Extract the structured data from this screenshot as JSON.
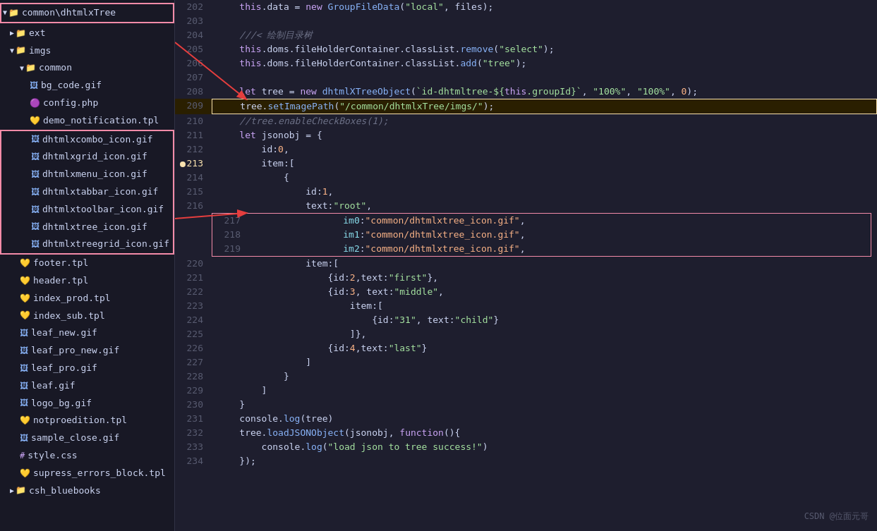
{
  "sidebar": {
    "items": [
      {
        "id": "root-common",
        "label": "common\\dhtmlxTree",
        "type": "folder-open",
        "indent": 0,
        "expanded": true,
        "highlighted": true
      },
      {
        "id": "ext",
        "label": "ext",
        "type": "folder-closed",
        "indent": 1,
        "expanded": false
      },
      {
        "id": "imgs",
        "label": "imgs",
        "type": "folder-open",
        "indent": 1,
        "expanded": true
      },
      {
        "id": "common",
        "label": "common",
        "type": "folder-open",
        "indent": 2,
        "expanded": true,
        "highlighted": true
      },
      {
        "id": "bg_code",
        "label": "bg_code.gif",
        "type": "gif",
        "indent": 3
      },
      {
        "id": "config",
        "label": "config.php",
        "type": "php",
        "indent": 3
      },
      {
        "id": "demo_notification",
        "label": "demo_notification.tpl",
        "type": "tpl",
        "indent": 3
      },
      {
        "id": "dhtmlxcombo_icon",
        "label": "dhtmlxcombo_icon.gif",
        "type": "gif",
        "indent": 3,
        "highlighted_start": true
      },
      {
        "id": "dhtmlxgrid_icon",
        "label": "dhtmlxgrid_icon.gif",
        "type": "gif",
        "indent": 3
      },
      {
        "id": "dhtmlxmenu_icon",
        "label": "dhtmlxmenu_icon.gif",
        "type": "gif",
        "indent": 3
      },
      {
        "id": "dhtmlxtabbar_icon",
        "label": "dhtmlxtabbar_icon.gif",
        "type": "gif",
        "indent": 3
      },
      {
        "id": "dhtmlxtoolbar_icon",
        "label": "dhtmlxtoolbar_icon.gif",
        "type": "gif",
        "indent": 3
      },
      {
        "id": "dhtmlxtree_icon",
        "label": "dhtmlxtree_icon.gif",
        "type": "gif",
        "indent": 3
      },
      {
        "id": "dhtmlxtreegrid_icon",
        "label": "dhtmlxtreegrid_icon.gif",
        "type": "gif",
        "indent": 3,
        "highlighted_end": true
      },
      {
        "id": "footer",
        "label": "footer.tpl",
        "type": "tpl",
        "indent": 2
      },
      {
        "id": "header",
        "label": "header.tpl",
        "type": "tpl",
        "indent": 2
      },
      {
        "id": "index_prod",
        "label": "index_prod.tpl",
        "type": "tpl",
        "indent": 2
      },
      {
        "id": "index_sub",
        "label": "index_sub.tpl",
        "type": "tpl",
        "indent": 2
      },
      {
        "id": "leaf_new",
        "label": "leaf_new.gif",
        "type": "gif",
        "indent": 2
      },
      {
        "id": "leaf_pro_new",
        "label": "leaf_pro_new.gif",
        "type": "gif",
        "indent": 2
      },
      {
        "id": "leaf_pro",
        "label": "leaf_pro.gif",
        "type": "gif",
        "indent": 2
      },
      {
        "id": "leaf",
        "label": "leaf.gif",
        "type": "gif",
        "indent": 2
      },
      {
        "id": "logo_bg",
        "label": "logo_bg.gif",
        "type": "gif",
        "indent": 2
      },
      {
        "id": "notproedition",
        "label": "notproedition.tpl",
        "type": "tpl",
        "indent": 2
      },
      {
        "id": "sample_close",
        "label": "sample_close.gif",
        "type": "gif",
        "indent": 2
      },
      {
        "id": "style",
        "label": "style.css",
        "type": "css",
        "indent": 2
      },
      {
        "id": "supress_errors_block",
        "label": "supress_errors_block.tpl",
        "type": "tpl",
        "indent": 2
      },
      {
        "id": "csh_bluebooks",
        "label": "csh_bluebooks",
        "type": "folder-closed",
        "indent": 1
      }
    ]
  },
  "code": {
    "lines": [
      {
        "num": 202,
        "content": "    this.data = new GroupFileData(\"local\", files);",
        "type": "normal"
      },
      {
        "num": 203,
        "content": "",
        "type": "normal"
      },
      {
        "num": 204,
        "content": "    ///< 绘制目录树",
        "type": "comment-zh"
      },
      {
        "num": 205,
        "content": "    this.doms.fileHolderContainer.classList.remove(\"select\");",
        "type": "normal"
      },
      {
        "num": 206,
        "content": "    this.doms.fileHolderContainer.classList.add(\"tree\");",
        "type": "normal"
      },
      {
        "num": 207,
        "content": "",
        "type": "normal"
      },
      {
        "num": 208,
        "content": "    let tree = new dhtmlXTreeObject(`id-dhtmltree-${this.groupId}`, \"100%\", \"100%\", 0);",
        "type": "normal"
      },
      {
        "num": 209,
        "content": "    tree.setImagePath(\"/common/dhtmlxTree/imgs/\");",
        "type": "highlight"
      },
      {
        "num": 210,
        "content": "    //tree.enableCheckBoxes(1);",
        "type": "comment"
      },
      {
        "num": 211,
        "content": "    let jsonobj = {",
        "type": "normal"
      },
      {
        "num": 212,
        "content": "        id:0,",
        "type": "normal"
      },
      {
        "num": 213,
        "content": "        item:[",
        "type": "dot"
      },
      {
        "num": 214,
        "content": "            {",
        "type": "normal"
      },
      {
        "num": 215,
        "content": "                id:1,",
        "type": "normal"
      },
      {
        "num": 216,
        "content": "                text:\"root\",",
        "type": "normal"
      },
      {
        "num": 217,
        "content": "                im0:\"common/dhtmlxtree_icon.gif\",",
        "type": "red-box"
      },
      {
        "num": 218,
        "content": "                im1:\"common/dhtmlxtree_icon.gif\",",
        "type": "red-box"
      },
      {
        "num": 219,
        "content": "                im2:\"common/dhtmlxtree_icon.gif\",",
        "type": "red-box"
      },
      {
        "num": 220,
        "content": "                item:[",
        "type": "normal"
      },
      {
        "num": 221,
        "content": "                    {id:2,text:\"first\"},",
        "type": "normal"
      },
      {
        "num": 222,
        "content": "                    {id:3, text:\"middle\",",
        "type": "normal"
      },
      {
        "num": 223,
        "content": "                        item:[",
        "type": "normal"
      },
      {
        "num": 224,
        "content": "                            {id:\"31\", text:\"child\"}",
        "type": "normal"
      },
      {
        "num": 225,
        "content": "                        ]},",
        "type": "normal"
      },
      {
        "num": 226,
        "content": "                    {id:4,text:\"last\"}",
        "type": "normal"
      },
      {
        "num": 227,
        "content": "                ]",
        "type": "normal"
      },
      {
        "num": 228,
        "content": "            }",
        "type": "normal"
      },
      {
        "num": 229,
        "content": "        ]",
        "type": "normal"
      },
      {
        "num": 230,
        "content": "    }",
        "type": "normal"
      },
      {
        "num": 231,
        "content": "    console.log(tree)",
        "type": "normal"
      },
      {
        "num": 232,
        "content": "    tree.loadJSONObject(jsonobj, function(){",
        "type": "normal"
      },
      {
        "num": 233,
        "content": "        console.log(\"load json to tree success!\")",
        "type": "normal"
      },
      {
        "num": 234,
        "content": "    });",
        "type": "normal"
      }
    ]
  },
  "watermark": "CSDN @位面元哥"
}
